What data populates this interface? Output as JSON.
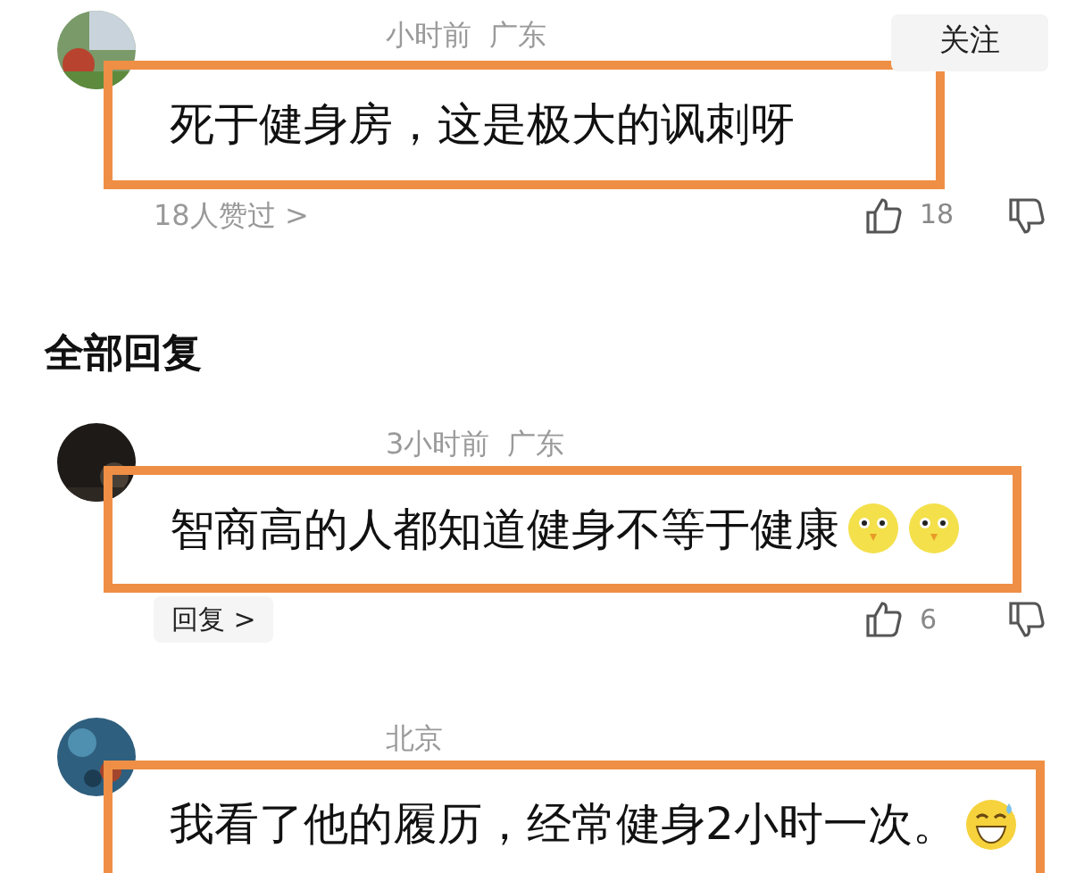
{
  "comments": [
    {
      "meta": [
        "小时前",
        "广东"
      ],
      "follow": "关注",
      "highlighted": true,
      "text": "死于健身房，这是极大的讽刺呀",
      "footer": {
        "kind": "plain",
        "label": "18人赞过 >"
      },
      "likes": "18"
    },
    {
      "meta": [
        "3小时前",
        "广东"
      ],
      "highlighted": true,
      "text": "智商高的人都知道健身不等于健康",
      "emojis": [
        {
          "kind": "chick"
        },
        {
          "kind": "chick"
        }
      ],
      "footer": {
        "kind": "pill",
        "label": "回复 >"
      },
      "likes": "6"
    },
    {
      "meta": [
        "北京"
      ],
      "highlighted": true,
      "text": "我看了他的履历，经常健身2小时一次。",
      "emojis": [
        {
          "kind": "grin"
        }
      ]
    }
  ],
  "section_title": "全部回复"
}
